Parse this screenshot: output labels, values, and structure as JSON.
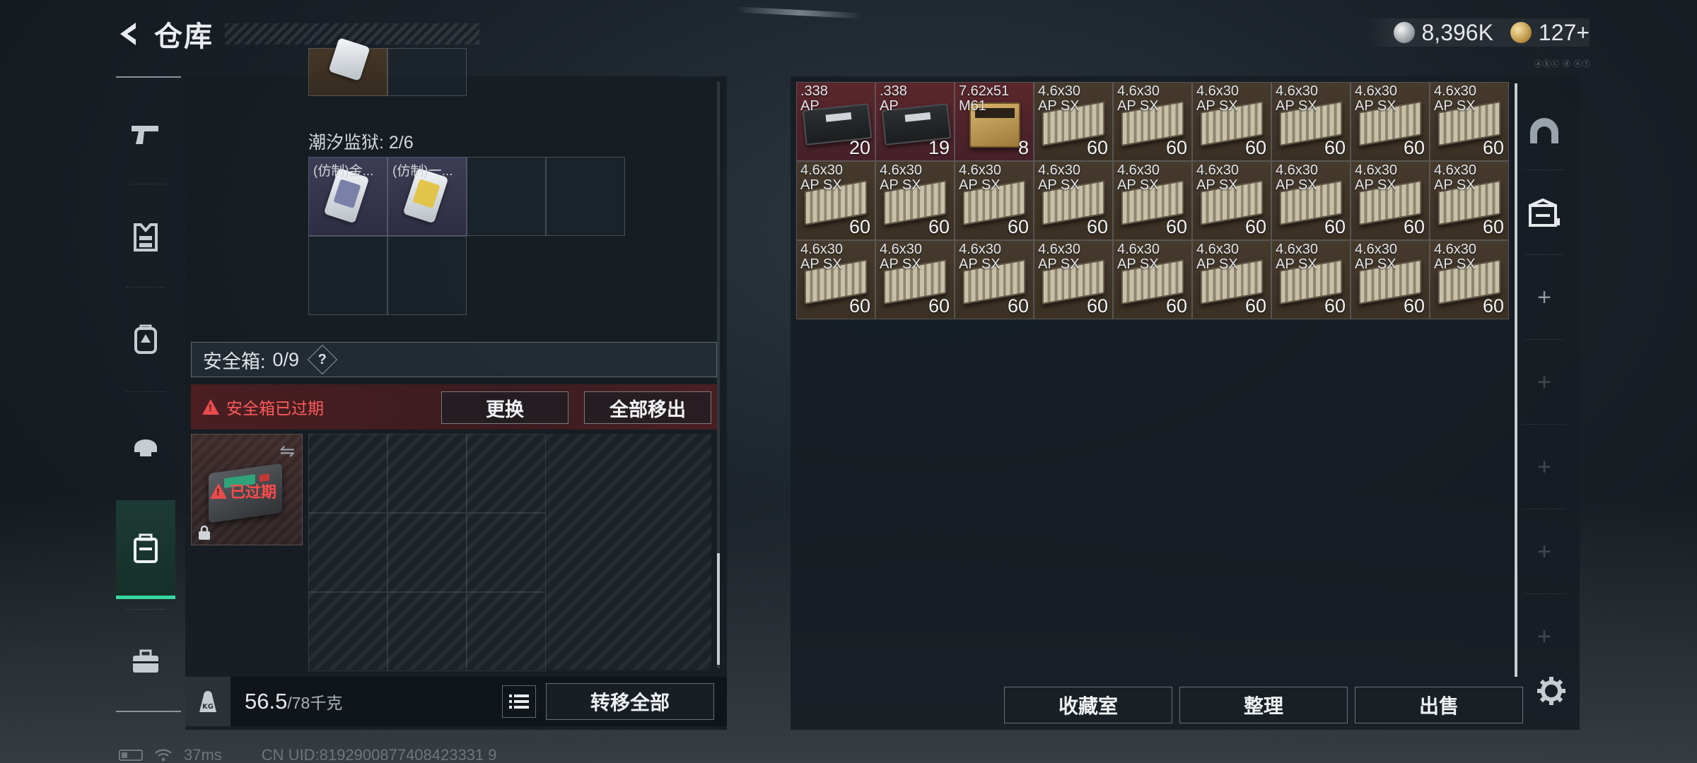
{
  "header": {
    "title": "仓库",
    "currency": [
      {
        "icon": "silver-coin-icon",
        "value": "8,396K"
      },
      {
        "icon": "gold-coin-icon",
        "value": "127+"
      }
    ],
    "small_tag": "ⓐⓑⓒ ⓓ ⓔⓕ"
  },
  "left_rail": {
    "items": [
      {
        "name": "weapon",
        "icon": "pistol-icon"
      },
      {
        "name": "armor",
        "icon": "vest-icon"
      },
      {
        "name": "backpack",
        "icon": "backpack-icon"
      },
      {
        "name": "helmet",
        "icon": "helmet-icon"
      },
      {
        "name": "safe-case",
        "icon": "case-icon",
        "active": true
      },
      {
        "name": "toolbox",
        "icon": "toolbox-icon"
      }
    ]
  },
  "left_panel": {
    "prison_label": "潮汐监狱: 2/6",
    "prison_items": [
      {
        "label": "(仿制)金...",
        "stripe": "#7a80a8"
      },
      {
        "label": "(仿制)一...",
        "stripe": "#e2c44a"
      }
    ],
    "safe_box": {
      "label": "安全箱:",
      "count": "0/9",
      "help": "?",
      "expired_warning": "安全箱已过期",
      "replace_btn": "更换",
      "move_all_btn": "全部移出",
      "overlay_text": "已过期"
    },
    "footer": {
      "kg_icon": "KG",
      "weight_current": "56.5",
      "weight_max": "/78千克",
      "transfer_all": "转移全部"
    }
  },
  "right_panel": {
    "ammo": [
      {
        "name": ".338\nAP",
        "count": "20",
        "tint": "red",
        "art": "dark"
      },
      {
        "name": ".338\nAP",
        "count": "19",
        "tint": "red",
        "art": "dark"
      },
      {
        "name": "7.62x51\nM61",
        "count": "8",
        "tint": "red",
        "art": "box"
      },
      {
        "name": "4.6x30\nAP SX",
        "count": "60",
        "tint": "brown",
        "art": "crate"
      },
      {
        "name": "4.6x30\nAP SX",
        "count": "60",
        "tint": "brown",
        "art": "crate"
      },
      {
        "name": "4.6x30\nAP SX",
        "count": "60",
        "tint": "brown",
        "art": "crate"
      },
      {
        "name": "4.6x30\nAP SX",
        "count": "60",
        "tint": "brown",
        "art": "crate"
      },
      {
        "name": "4.6x30\nAP SX",
        "count": "60",
        "tint": "brown",
        "art": "crate"
      },
      {
        "name": "4.6x30\nAP SX",
        "count": "60",
        "tint": "brown",
        "art": "crate"
      },
      {
        "name": "4.6x30\nAP SX",
        "count": "60",
        "tint": "brown",
        "art": "crate"
      },
      {
        "name": "4.6x30\nAP SX",
        "count": "60",
        "tint": "brown",
        "art": "crate"
      },
      {
        "name": "4.6x30\nAP SX",
        "count": "60",
        "tint": "brown",
        "art": "crate"
      },
      {
        "name": "4.6x30\nAP SX",
        "count": "60",
        "tint": "brown",
        "art": "crate"
      },
      {
        "name": "4.6x30\nAP SX",
        "count": "60",
        "tint": "brown",
        "art": "crate"
      },
      {
        "name": "4.6x30\nAP SX",
        "count": "60",
        "tint": "brown",
        "art": "crate"
      },
      {
        "name": "4.6x30\nAP SX",
        "count": "60",
        "tint": "brown",
        "art": "crate"
      },
      {
        "name": "4.6x30\nAP SX",
        "count": "60",
        "tint": "brown",
        "art": "crate"
      },
      {
        "name": "4.6x30\nAP SX",
        "count": "60",
        "tint": "brown",
        "art": "crate"
      },
      {
        "name": "4.6x30\nAP SX",
        "count": "60",
        "tint": "brown",
        "art": "crate"
      },
      {
        "name": "4.6x30\nAP SX",
        "count": "60",
        "tint": "brown",
        "art": "crate"
      },
      {
        "name": "4.6x30\nAP SX",
        "count": "60",
        "tint": "brown",
        "art": "crate"
      },
      {
        "name": "4.6x30\nAP SX",
        "count": "60",
        "tint": "brown",
        "art": "crate"
      },
      {
        "name": "4.6x30\nAP SX",
        "count": "60",
        "tint": "brown",
        "art": "crate"
      },
      {
        "name": "4.6x30\nAP SX",
        "count": "60",
        "tint": "brown",
        "art": "crate"
      },
      {
        "name": "4.6x30\nAP SX",
        "count": "60",
        "tint": "brown",
        "art": "crate"
      },
      {
        "name": "4.6x30\nAP SX",
        "count": "60",
        "tint": "brown",
        "art": "crate"
      },
      {
        "name": "4.6x30\nAP SX",
        "count": "60",
        "tint": "brown",
        "art": "crate"
      }
    ],
    "footer": {
      "collection": "收藏室",
      "sort": "整理",
      "sell": "出售"
    },
    "rail": [
      {
        "icon": "dome-icon"
      },
      {
        "icon": "warehouse-icon"
      },
      {
        "icon": "plus-icon",
        "symbol": "+"
      },
      {
        "icon": "plus-icon",
        "symbol": "+"
      },
      {
        "icon": "plus-icon",
        "symbol": "+"
      },
      {
        "icon": "plus-icon",
        "symbol": "+"
      },
      {
        "icon": "plus-icon",
        "symbol": "+"
      }
    ]
  },
  "status_bar": {
    "ping": "37ms",
    "uid": "CN UID:8192900877408423331 9"
  },
  "colors": {
    "accent_green": "#36d7a0",
    "warning_red": "#ff5a5a"
  }
}
